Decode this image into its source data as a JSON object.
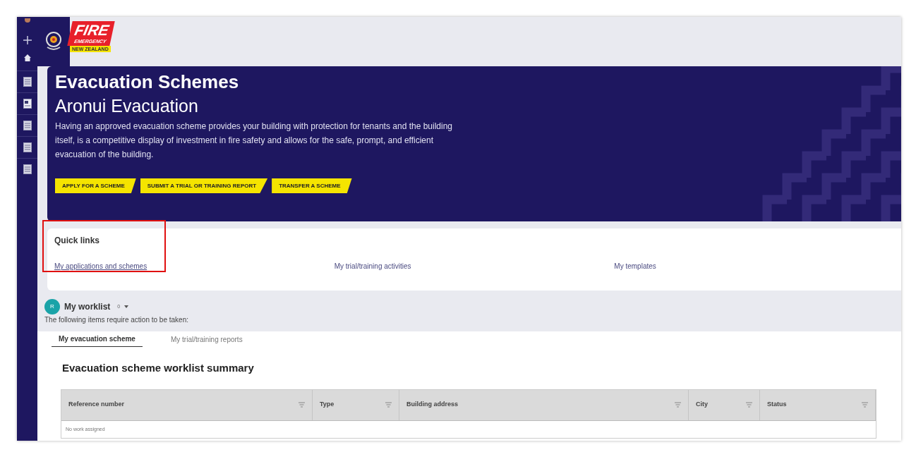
{
  "logo": {
    "title": "FIRE",
    "subtitle": "EMERGENCY",
    "country": "NEW ZEALAND"
  },
  "sidebar": {
    "items": [
      {
        "kind": "plus"
      },
      {
        "kind": "home"
      },
      {
        "kind": "doc"
      },
      {
        "kind": "card"
      },
      {
        "kind": "doc"
      },
      {
        "kind": "doc"
      },
      {
        "kind": "doc"
      }
    ]
  },
  "banner": {
    "title": "Evacuation Schemes",
    "subtitle": "Aronui Evacuation",
    "description": "Having an approved evacuation scheme provides your building with protection for tenants and the building itself, is a competitive display of investment in fire safety and allows for the safe, prompt, and efficient evacuation of the building.",
    "buttons": [
      "APPLY FOR A SCHEME",
      "SUBMIT A TRIAL OR TRAINING REPORT",
      "TRANSFER A SCHEME"
    ]
  },
  "quick_links": {
    "title": "Quick links",
    "links": [
      {
        "label": "My applications and schemes",
        "highlighted": true
      },
      {
        "label": "My trial/training activities",
        "highlighted": false
      },
      {
        "label": "My templates",
        "highlighted": false
      }
    ]
  },
  "worklist": {
    "avatar": "R",
    "title": "My worklist",
    "count": "0",
    "description": "The following items require action to be taken:"
  },
  "tabs": [
    {
      "label": "My evacuation scheme",
      "selected": true
    },
    {
      "label": "My trial/training reports",
      "selected": false
    }
  ],
  "table": {
    "title": "Evacuation scheme worklist summary",
    "columns": [
      "Reference number",
      "Type",
      "Building address",
      "City",
      "Status"
    ],
    "empty_message": "No work assigned"
  }
}
